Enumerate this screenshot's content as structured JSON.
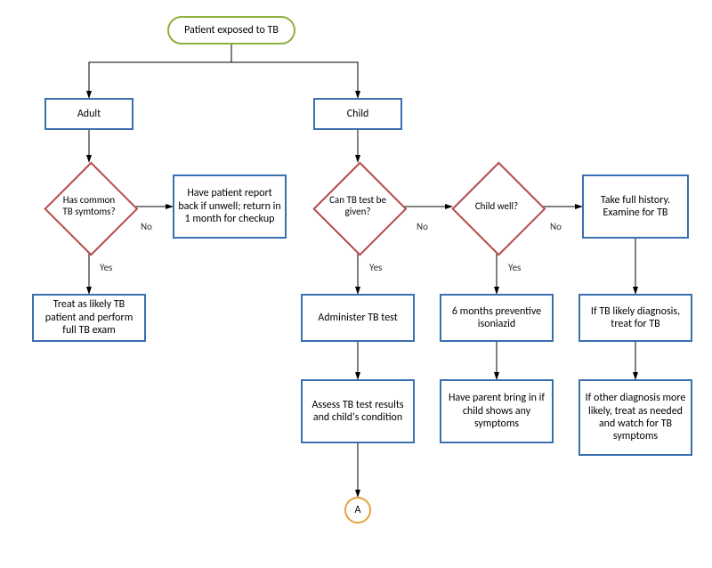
{
  "chart_data": {
    "type": "flowchart",
    "nodes": {
      "start": {
        "kind": "terminator",
        "text": "Patient exposed to TB"
      },
      "adult": {
        "kind": "process",
        "text": "Adult"
      },
      "child": {
        "kind": "process",
        "text": "Child"
      },
      "has_symptoms": {
        "kind": "decision",
        "text": "Has common TB symtoms?"
      },
      "report_back": {
        "kind": "process",
        "text": "Have patient report back if unwell; return in 1 month for checkup"
      },
      "full_exam": {
        "kind": "process",
        "text": "Treat as likely TB patient and perform full TB exam"
      },
      "can_tb_test": {
        "kind": "decision",
        "text": "Can TB test be given?"
      },
      "child_well": {
        "kind": "decision",
        "text": "Child well?"
      },
      "take_history": {
        "kind": "process",
        "text": "Take full history. Examine for TB"
      },
      "administer": {
        "kind": "process",
        "text": "Administer TB test"
      },
      "preventive": {
        "kind": "process",
        "text": "6 months preventive isoniazid"
      },
      "likely_diag": {
        "kind": "process",
        "text": "If TB likely diagnosis, treat for TB"
      },
      "assess": {
        "kind": "process",
        "text": "Assess TB test results and child's condition"
      },
      "parent_bring": {
        "kind": "process",
        "text": "Have parent bring in if child shows any symptoms"
      },
      "other_diag": {
        "kind": "process",
        "text": "If other diagnosis more likely, treat as needed and watch for TB symptoms"
      },
      "connector_a": {
        "kind": "connector",
        "text": "A"
      }
    },
    "edges": [
      {
        "from": "start",
        "to": "adult",
        "label": ""
      },
      {
        "from": "start",
        "to": "child",
        "label": ""
      },
      {
        "from": "adult",
        "to": "has_symptoms",
        "label": ""
      },
      {
        "from": "has_symptoms",
        "to": "report_back",
        "label": "No"
      },
      {
        "from": "has_symptoms",
        "to": "full_exam",
        "label": "Yes"
      },
      {
        "from": "child",
        "to": "can_tb_test",
        "label": ""
      },
      {
        "from": "can_tb_test",
        "to": "administer",
        "label": "Yes"
      },
      {
        "from": "can_tb_test",
        "to": "child_well",
        "label": "No"
      },
      {
        "from": "child_well",
        "to": "preventive",
        "label": "Yes"
      },
      {
        "from": "child_well",
        "to": "take_history",
        "label": "No"
      },
      {
        "from": "administer",
        "to": "assess",
        "label": ""
      },
      {
        "from": "assess",
        "to": "connector_a",
        "label": ""
      },
      {
        "from": "preventive",
        "to": "parent_bring",
        "label": ""
      },
      {
        "from": "take_history",
        "to": "likely_diag",
        "label": ""
      },
      {
        "from": "likely_diag",
        "to": "other_diag",
        "label": ""
      }
    ],
    "edge_labels": {
      "yes": "Yes",
      "no": "No"
    }
  }
}
